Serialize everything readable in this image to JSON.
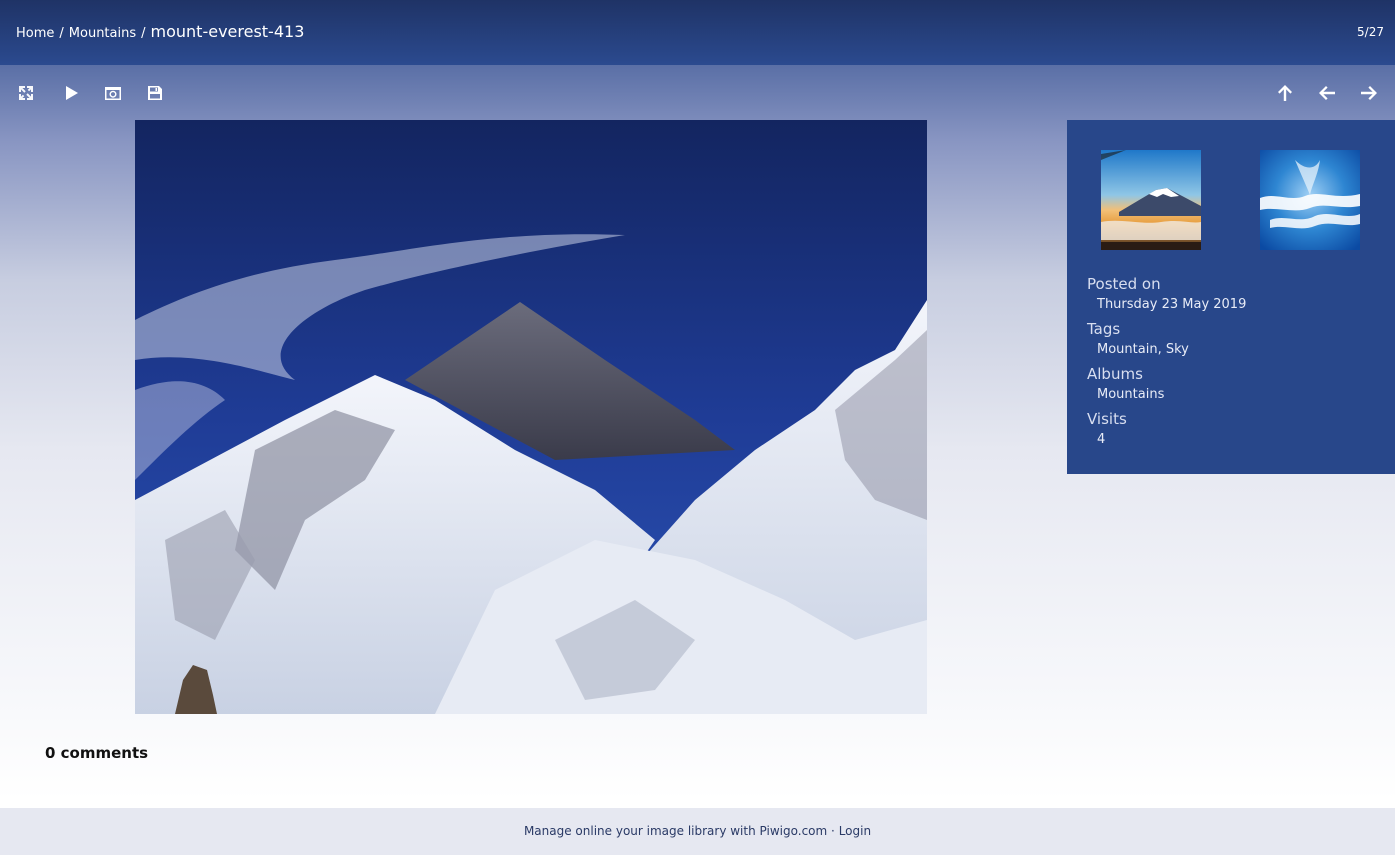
{
  "breadcrumb": {
    "home": "Home",
    "separator": "/",
    "album": "Mountains",
    "current": "mount-everest-413"
  },
  "counter": "5/27",
  "toolbar": {
    "left": [
      "fullscreen-icon",
      "slideshow-play-icon",
      "camera-icon",
      "save-icon"
    ],
    "right": [
      "up-arrow-icon",
      "previous-arrow-icon",
      "next-arrow-icon"
    ]
  },
  "image": {
    "subject": "mount-everest-413"
  },
  "info": {
    "posted_label": "Posted on",
    "posted_value": "Thursday 23 May 2019",
    "tags_label": "Tags",
    "tags": [
      "Mountain",
      "Sky"
    ],
    "tag_separator": ", ",
    "albums_label": "Albums",
    "album_value": "Mountains",
    "visits_label": "Visits",
    "visits_value": "4"
  },
  "comments": {
    "label": "0 comments"
  },
  "footer": {
    "text": "Manage online your image library with",
    "link": "Piwigo.com",
    "separator": "·",
    "login": "Login"
  },
  "colors": {
    "header": "#1f3366",
    "panel": "#28478a",
    "footer_bg": "#e6e8f1"
  }
}
